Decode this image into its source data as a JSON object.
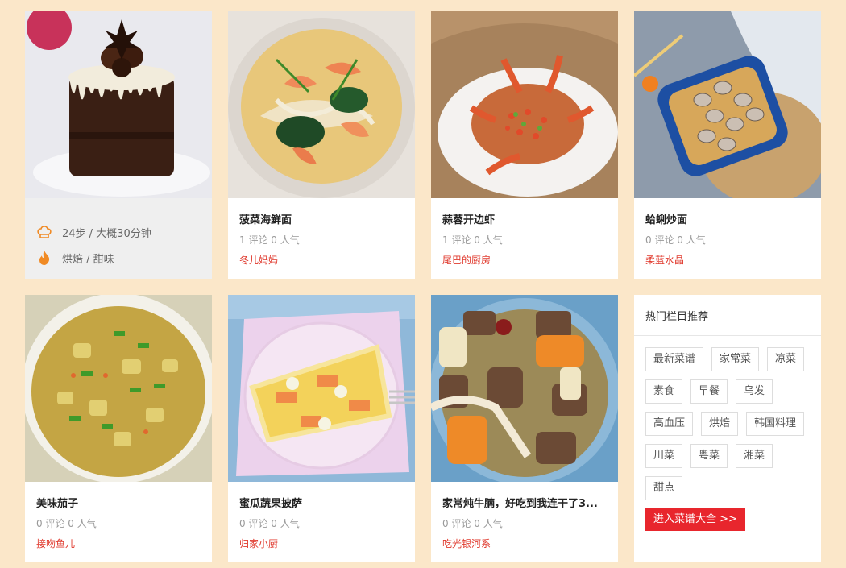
{
  "cards": [
    {
      "title": "",
      "hover": {
        "steps": "24步 / 大概30分钟",
        "tags": "烘焙 / 甜味"
      }
    },
    {
      "title": "菠菜海鲜面",
      "meta": "1 评论 0 人气",
      "author": "冬儿妈妈"
    },
    {
      "title": "蒜蓉开边虾",
      "meta": "1 评论 0 人气",
      "author": "尾巴的厨房"
    },
    {
      "title": "蛤蜊炒面",
      "meta": "0 评论 0 人气",
      "author": "柔蓝水晶"
    },
    {
      "title": "美味茄子",
      "meta": "0 评论 0 人气",
      "author": "接吻鱼儿"
    },
    {
      "title": "蜜瓜蔬果披萨",
      "meta": "0 评论 0 人气",
      "author": "归家小厨"
    },
    {
      "title": "家常炖牛腩，好吃到我连干了3...",
      "meta": "0 评论 0 人气",
      "author": "吃光银河系"
    }
  ],
  "panel": {
    "title": "热门栏目推荐",
    "tags": [
      "最新菜谱",
      "家常菜",
      "凉菜",
      "素食",
      "早餐",
      "乌发",
      "高血压",
      "烘焙",
      "韩国料理",
      "川菜",
      "粤菜",
      "湘菜",
      "甜点"
    ],
    "button": "进入菜谱大全 >>"
  },
  "colors": {
    "background": "#fbe7c9",
    "accent": "#e8262d",
    "author": "#e03a2e"
  },
  "icons": {
    "steps": "chef-hat-icon",
    "taste": "flame-icon"
  }
}
